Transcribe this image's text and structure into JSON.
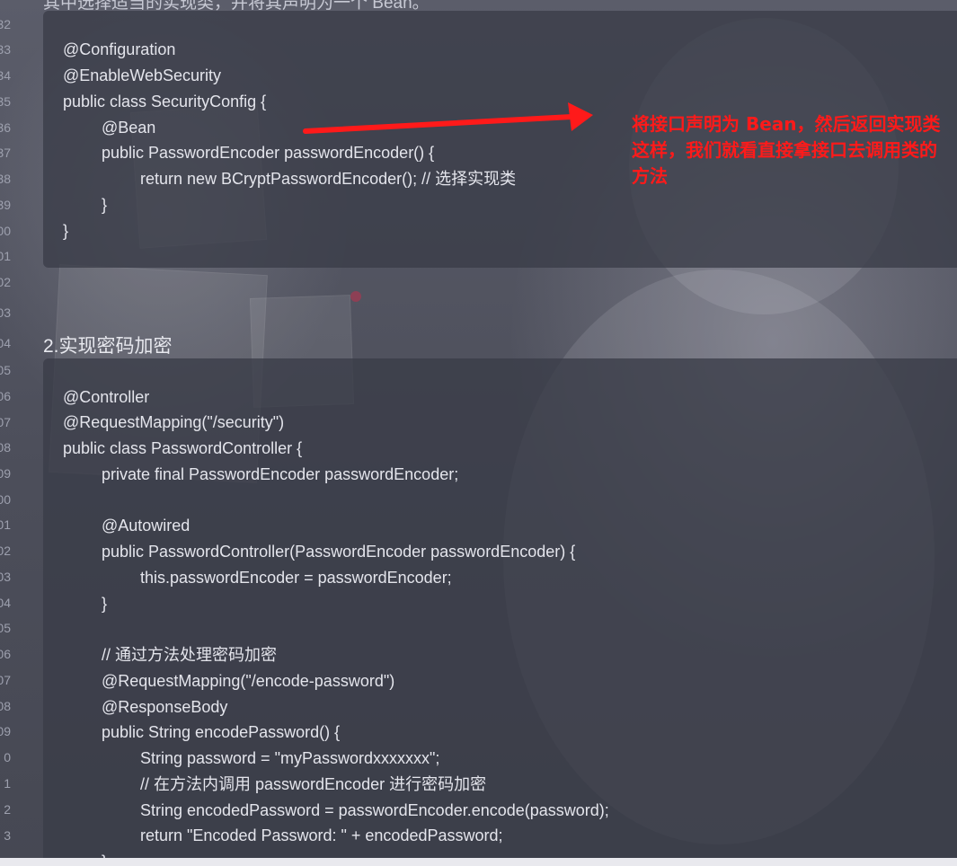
{
  "gutter_numbers": [
    "32",
    "33",
    "34",
    "35",
    "36",
    "37",
    "38",
    "39",
    "00",
    "01",
    "02",
    "03",
    "04",
    "05",
    "06",
    "07",
    "08",
    "09",
    "00",
    "01",
    "02",
    "03",
    "04",
    "05",
    "06",
    "07",
    "08",
    "09",
    "0",
    "1",
    "2",
    "3"
  ],
  "document": {
    "partial_top_text": "其中选择适当的实现类，并将其声明为一个 Bean。",
    "block1_lines": [
      "@Configuration",
      "@EnableWebSecurity",
      "public class SecurityConfig {",
      "@Bean",
      "public PasswordEncoder passwordEncoder() {",
      "return new BCryptPasswordEncoder(); // 选择实现类",
      "}",
      "}"
    ],
    "section_heading": "2.实现密码加密",
    "block2_lines": [
      "@Controller",
      "@RequestMapping(\"/security\")",
      "public class PasswordController {",
      "private final PasswordEncoder passwordEncoder;",
      "",
      "@Autowired",
      "public PasswordController(PasswordEncoder passwordEncoder) {",
      "this.passwordEncoder = passwordEncoder;",
      "}",
      "",
      "// 通过方法处理密码加密",
      "@RequestMapping(\"/encode-password\")",
      "@ResponseBody",
      "public String encodePassword() {",
      "String password = \"myPasswordxxxxxxx\";",
      "// 在方法内调用 passwordEncoder 进行密码加密",
      "String encodedPassword = passwordEncoder.encode(password);",
      "return \"Encoded Password: \" + encodedPassword;",
      "}"
    ]
  },
  "annotation": {
    "lines": [
      "将接口声明为 Bean，然后返回实现类",
      "这样，我们就看直接拿接口去调用类的方法"
    ],
    "color": "#ff1a1a"
  },
  "colors": {
    "code_text": "#e4e5ec",
    "code_block_bg": "#3a3c48",
    "arrow": "#ff1a1a"
  }
}
